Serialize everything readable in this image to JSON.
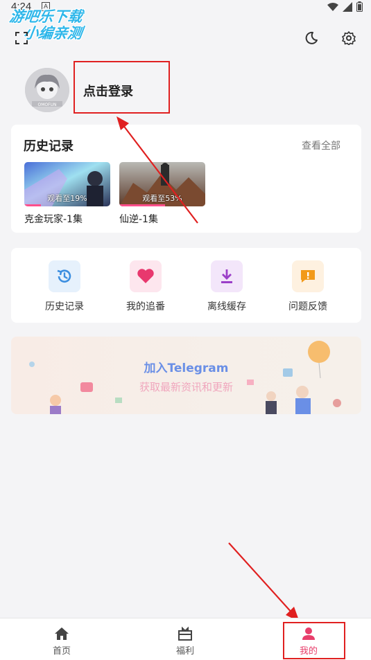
{
  "status_bar": {
    "time": "4:24",
    "notification": "A"
  },
  "watermark": {
    "line1": "游吧乐下载",
    "line2": "小编亲测"
  },
  "header": {
    "scan_icon": "scan-icon",
    "theme_icon": "moon-icon",
    "settings_icon": "gear-icon"
  },
  "profile": {
    "login_text": "点击登录",
    "avatar_caption": "OMOFUN"
  },
  "history": {
    "title": "历史记录",
    "view_all": "查看全部",
    "items": [
      {
        "title": "克金玩家-1集",
        "progress_label": "观看至19%",
        "progress": 0.19
      },
      {
        "title": "仙逆-1集",
        "progress_label": "观看至53%",
        "progress": 0.53
      }
    ]
  },
  "quick_actions": [
    {
      "label": "历史记录",
      "icon": "history-icon",
      "color": "#3d8fe0",
      "bg": "#e6f1fc"
    },
    {
      "label": "我的追番",
      "icon": "heart-icon",
      "color": "#e8386e",
      "bg": "#fde6ee"
    },
    {
      "label": "离线缓存",
      "icon": "download-icon",
      "color": "#9b3fc8",
      "bg": "#f3e6fa"
    },
    {
      "label": "问题反馈",
      "icon": "feedback-icon",
      "color": "#f29a1a",
      "bg": "#fef1e0"
    }
  ],
  "banner": {
    "title": "加入Telegram",
    "subtitle": "获取最新资讯和更新"
  },
  "bottom_nav": [
    {
      "label": "首页",
      "icon": "home-icon",
      "active": false
    },
    {
      "label": "福利",
      "icon": "gift-icon",
      "active": false
    },
    {
      "label": "我的",
      "icon": "user-icon",
      "active": true
    }
  ]
}
